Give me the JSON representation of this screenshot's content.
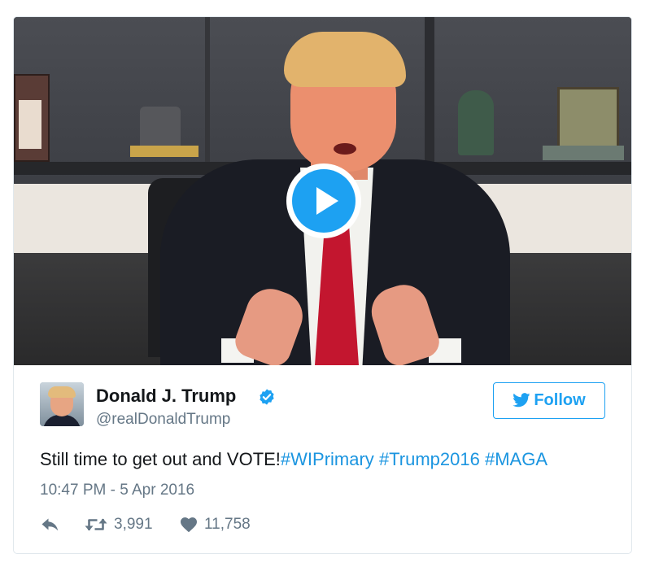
{
  "media": {
    "type": "video",
    "play_icon": "play-icon"
  },
  "author": {
    "name": "Donald J. Trump",
    "handle": "@realDonaldTrump",
    "verified_icon": "verified-badge-icon"
  },
  "follow_button": {
    "label": "Follow",
    "icon": "twitter-bird-icon",
    "color": "#1da1f2"
  },
  "tweet": {
    "text": "Still time to get out and VOTE!",
    "hashtags": [
      "#WIPrimary",
      "#Trump2016",
      "#MAGA"
    ],
    "timestamp": "10:47 PM - 5 Apr 2016"
  },
  "actions": {
    "reply_icon": "reply-icon",
    "retweet_icon": "retweet-icon",
    "retweet_count": "3,991",
    "like_icon": "heart-icon",
    "like_count": "11,758"
  },
  "colors": {
    "link": "#1b95e0",
    "muted": "#657786",
    "text": "#14171a"
  }
}
